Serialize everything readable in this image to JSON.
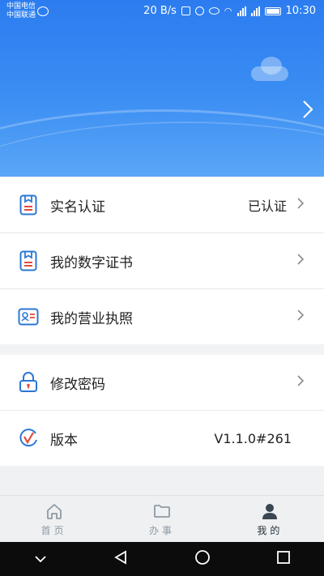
{
  "status_bar": {
    "carrier1": "中国电信",
    "carrier2": "中国联通",
    "speed": "20 B/s",
    "time": "10:30"
  },
  "menu": {
    "real_name": {
      "label": "实名认证",
      "value": "已认证"
    },
    "digital_cert": {
      "label": "我的数字证书"
    },
    "license": {
      "label": "我的营业执照"
    },
    "change_password": {
      "label": "修改密码"
    },
    "version": {
      "label": "版本",
      "value": "V1.1.0#261"
    }
  },
  "tabs": [
    {
      "label": "首页",
      "icon": "home-icon"
    },
    {
      "label": "办事",
      "icon": "folder-icon"
    },
    {
      "label": "我的",
      "icon": "person-icon",
      "active": true
    }
  ],
  "colors": {
    "banner": "#3b8ef3",
    "icon_blue": "#2a77d6",
    "icon_red": "#e24b3b"
  }
}
